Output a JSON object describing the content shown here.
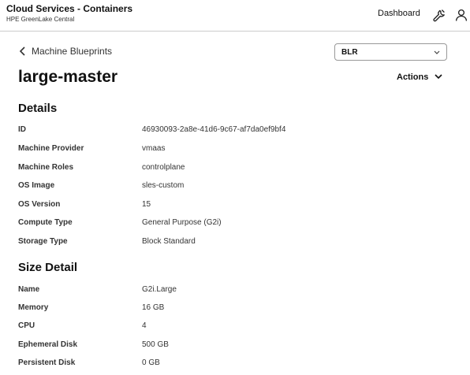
{
  "header": {
    "title": "Cloud Services - Containers",
    "subtitle": "HPE GreenLake Central",
    "dashboard": "Dashboard",
    "icons": [
      "wrench-icon",
      "user-icon"
    ]
  },
  "nav": {
    "back_label": "Machine Blueprints"
  },
  "region_select": {
    "value": "BLR"
  },
  "page": {
    "title": "large-master",
    "actions_label": "Actions"
  },
  "details": {
    "title": "Details",
    "rows": [
      {
        "label": "ID",
        "value": "46930093-2a8e-41d6-9c67-af7da0ef9bf4"
      },
      {
        "label": "Machine Provider",
        "value": "vmaas"
      },
      {
        "label": "Machine Roles",
        "value": "controlplane"
      },
      {
        "label": "OS Image",
        "value": "sles-custom"
      },
      {
        "label": "OS Version",
        "value": "15"
      },
      {
        "label": "Compute Type",
        "value": "General Purpose (G2i)"
      },
      {
        "label": "Storage Type",
        "value": "Block Standard"
      }
    ]
  },
  "size_detail": {
    "title": "Size Detail",
    "rows": [
      {
        "label": "Name",
        "value": "G2i.Large"
      },
      {
        "label": "Memory",
        "value": "16 GB"
      },
      {
        "label": "CPU",
        "value": "4"
      },
      {
        "label": "Ephemeral Disk",
        "value": "500 GB"
      },
      {
        "label": "Persistent Disk",
        "value": "0 GB"
      }
    ]
  }
}
